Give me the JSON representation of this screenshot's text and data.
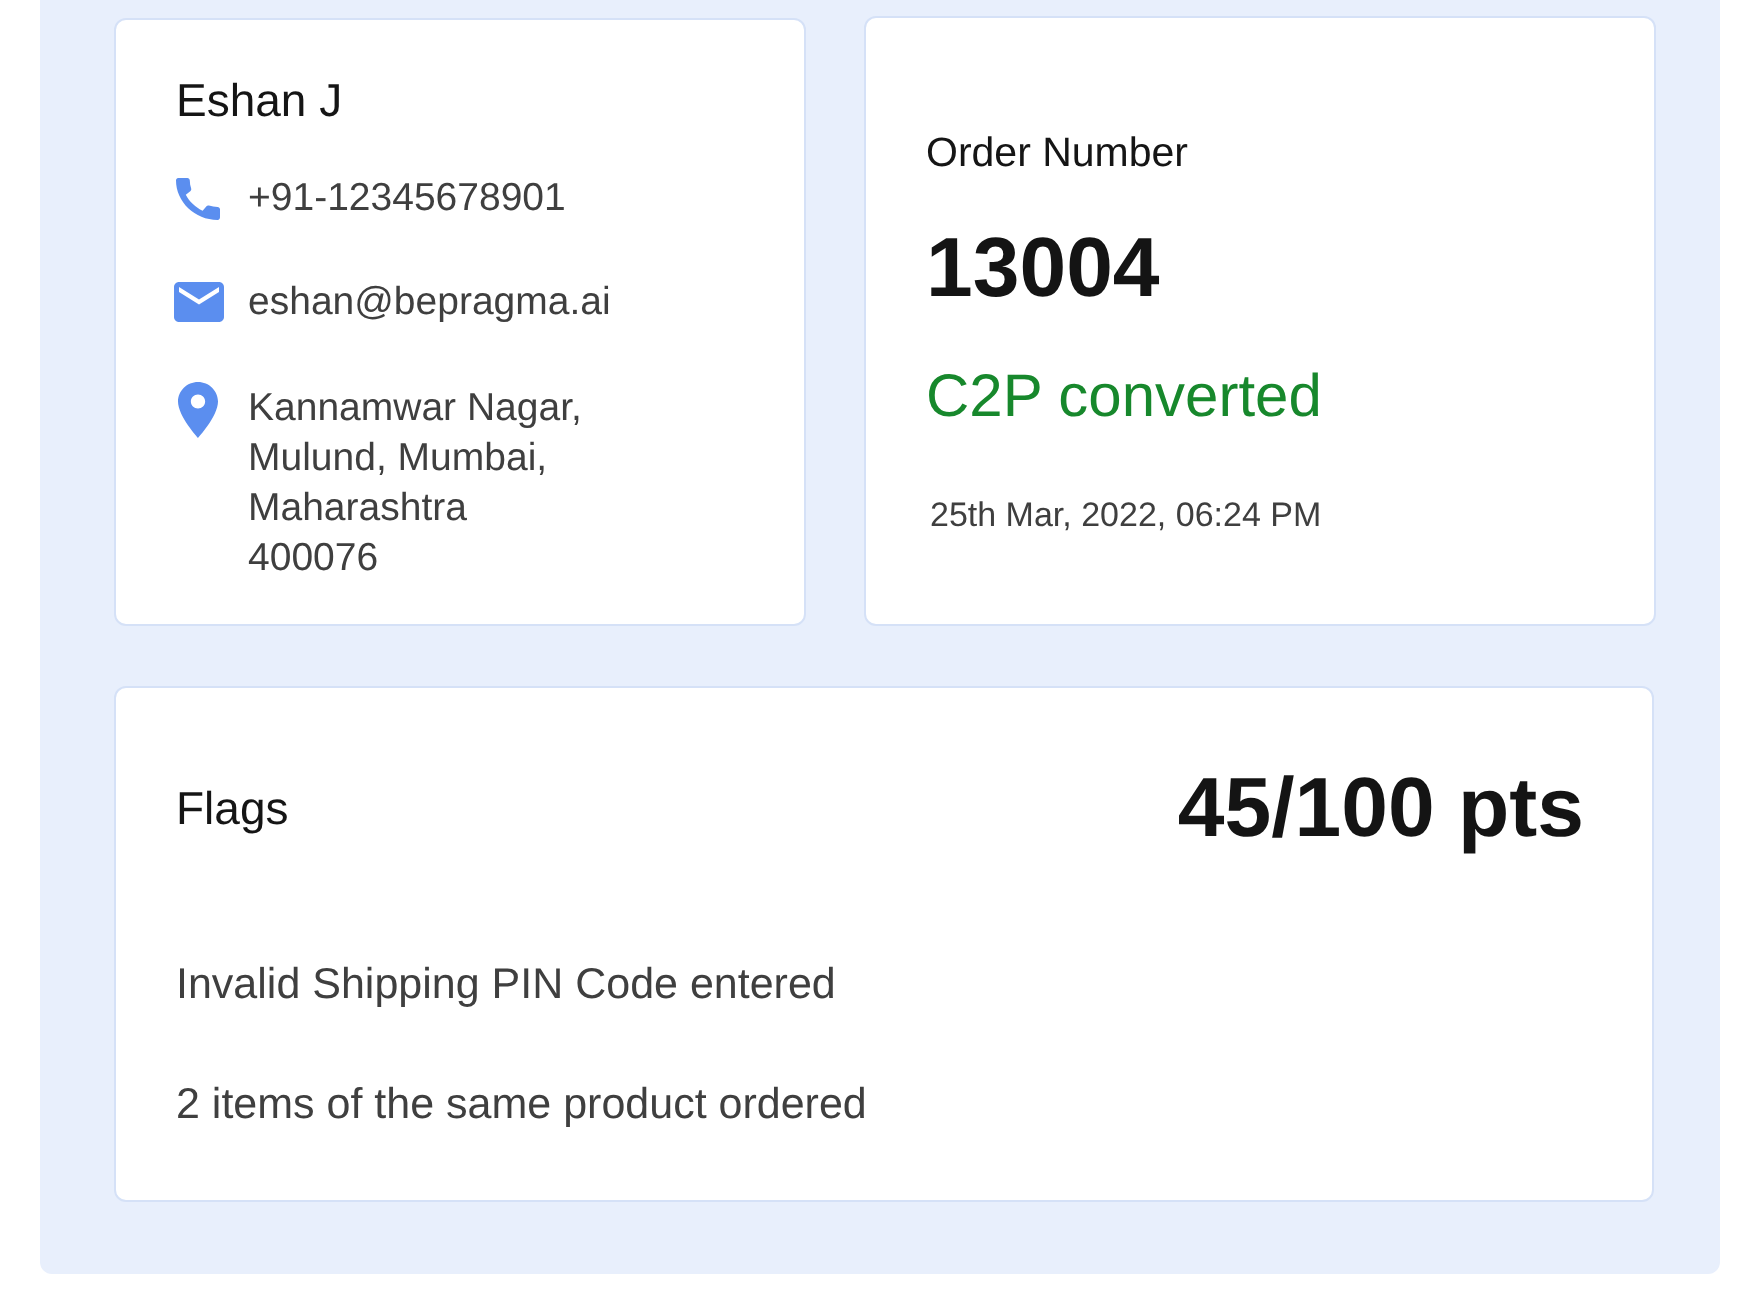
{
  "customer": {
    "name": "Eshan J",
    "contacts": [
      {
        "kind": "phone",
        "text": "+91-12345678901"
      },
      {
        "kind": "email",
        "text": "eshan@bepragma.ai"
      },
      {
        "kind": "address",
        "lines": [
          "Kannamwar Nagar,",
          "Mulund, Mumbai,",
          "Maharashtra",
          "400076"
        ]
      }
    ]
  },
  "order": {
    "label": "Order Number",
    "number": "13004",
    "status": {
      "text": "C2P converted",
      "kind": "success"
    },
    "date": "25th Mar, 2022, 06:24 PM"
  },
  "flags": {
    "title": "Flags",
    "score": "45/100 pts",
    "items": [
      "Invalid Shipping PIN Code entered",
      "2 items of the same product ordered"
    ]
  }
}
